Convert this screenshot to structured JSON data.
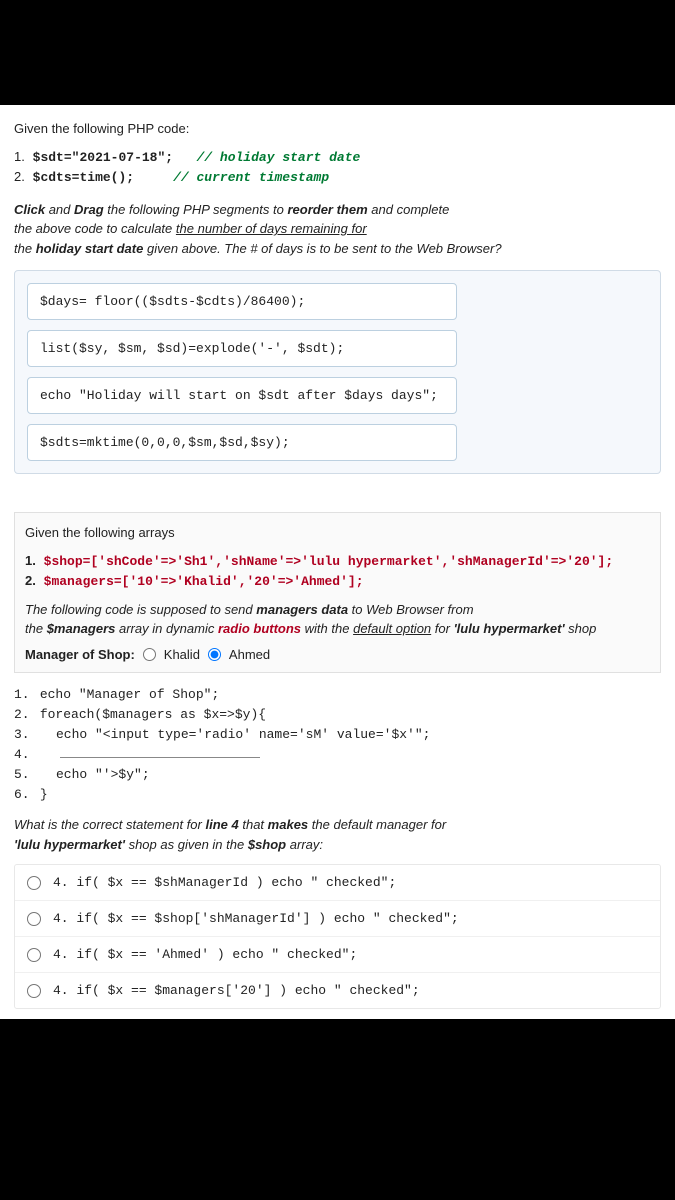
{
  "q1": {
    "intro": "Given the following PHP code:",
    "line1_num": "1.",
    "line1_code": "$sdt=\"2021-07-18\";",
    "line1_comment": "// holiday start date",
    "line2_num": "2.",
    "line2_code": "$cdts=time();",
    "line2_comment": "// current timestamp",
    "instr_click": "Click",
    "instr_and1": "and",
    "instr_drag": "Drag",
    "instr_mid": "the following PHP segments to",
    "instr_reorder": "reorder them",
    "instr_and2": "and complete",
    "instr_line2a": "the above code to calculate",
    "instr_underlined": "the number of days remaining for",
    "instr_line3a": "the",
    "instr_line3b": "holiday start date",
    "instr_line3c": "given above. The # of days is to be sent to the Web Browser?",
    "blocks": [
      "$days= floor(($sdts-$cdts)/86400);",
      "list($sy, $sm, $sd)=explode('-', $sdt);",
      "echo \"Holiday will start on $sdt after $days days\";",
      "$sdts=mktime(0,0,0,$sm,$sd,$sy);"
    ]
  },
  "q2": {
    "intro": "Given the following arrays",
    "arr1_num": "1.",
    "arr1_code": "$shop=['shCode'=>'Sh1','shName'=>'lulu hypermarket','shManagerId'=>'20'];",
    "arr2_num": "2.",
    "arr2_code": "$managers=['10'=>'Khalid','20'=>'Ahmed'];",
    "desc_a": "The following code is supposed to send",
    "desc_b": "managers data",
    "desc_c": "to Web Browser from",
    "desc_d": "the",
    "desc_e": "$managers",
    "desc_f": "array in dynamic",
    "desc_g": "radio buttons",
    "desc_h": "with the",
    "desc_i": "default option",
    "desc_j": "for",
    "desc_k": "'lulu hypermarket'",
    "desc_l": "shop",
    "mgr_label": "Manager of Shop:",
    "radio_khalid": "Khalid",
    "radio_ahmed": "Ahmed",
    "code": {
      "l1n": "1.",
      "l1": "echo \"Manager of Shop\";",
      "l2n": "2.",
      "l2": "foreach($managers as $x=>$y){",
      "l3n": "3.",
      "l3": "echo \"<input type='radio' name='sM' value='$x'\";",
      "l4n": "4.",
      "l5n": "5.",
      "l5": "echo \"'>$y\";",
      "l6n": "6.",
      "l6": "}"
    },
    "ask_a": "What is the correct statement for",
    "ask_b": "line 4",
    "ask_c": "that",
    "ask_d": "makes",
    "ask_e": "the default manager for",
    "ask_f": "'lulu hypermarket'",
    "ask_g": "shop as given in the",
    "ask_h": "$shop",
    "ask_i": "array:",
    "options": [
      "4. if( $x == $shManagerId ) echo \" checked\";",
      "4. if( $x == $shop['shManagerId'] ) echo \" checked\";",
      "4. if( $x == 'Ahmed' ) echo \" checked\";",
      "4. if( $x == $managers['20'] ) echo \" checked\";"
    ]
  }
}
